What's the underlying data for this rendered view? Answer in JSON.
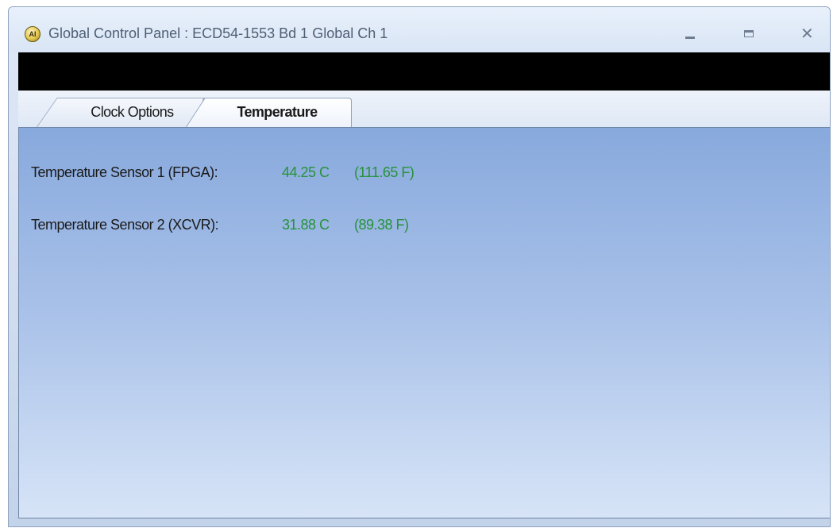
{
  "window": {
    "title": "Global Control Panel : ECD54-1553 Bd 1 Global Ch 1",
    "app_icon_glyph": "AI",
    "controls": {
      "minimize_icon": "minimize-icon",
      "maximize_icon": "maximize-icon",
      "close_glyph": "✕"
    }
  },
  "tabs": [
    {
      "label": "Clock Options",
      "selected": false
    },
    {
      "label": "Temperature",
      "selected": true
    }
  ],
  "sensors": [
    {
      "label": "Temperature Sensor 1 (FPGA):",
      "celsius": "44.25 C",
      "fahrenheit": "(111.65 F)"
    },
    {
      "label": "Temperature Sensor 2 (XCVR):",
      "celsius": "31.88 C",
      "fahrenheit": "(89.38 F)"
    }
  ],
  "colors": {
    "value_text": "#27923a",
    "panel_top": "#88a9dd",
    "panel_bottom": "#d7e4f7",
    "header_bar": "#000000"
  }
}
